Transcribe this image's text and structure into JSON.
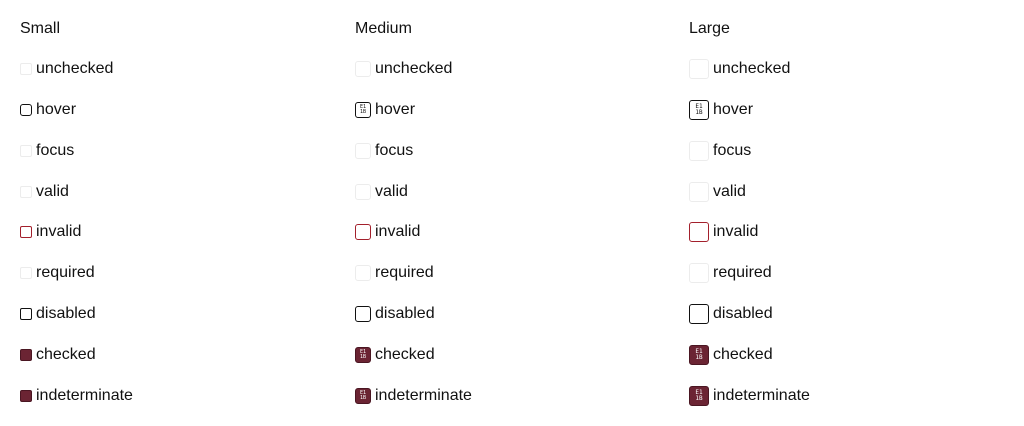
{
  "columns": [
    {
      "title": "Small"
    },
    {
      "title": "Medium"
    },
    {
      "title": "Large"
    }
  ],
  "states": [
    {
      "label": "unchecked"
    },
    {
      "label": "hover"
    },
    {
      "label": "focus"
    },
    {
      "label": "valid"
    },
    {
      "label": "invalid"
    },
    {
      "label": "required"
    },
    {
      "label": "disabled"
    },
    {
      "label": "checked"
    },
    {
      "label": "indeterminate"
    }
  ],
  "icon": {
    "name": "missing-glyph-icon",
    "lines": [
      "E1",
      "1B"
    ]
  },
  "colors": {
    "accent_fill": "#6b2433",
    "invalid_border": "#a3202c",
    "default_border": "#ececec",
    "strong_border": "#111111"
  }
}
